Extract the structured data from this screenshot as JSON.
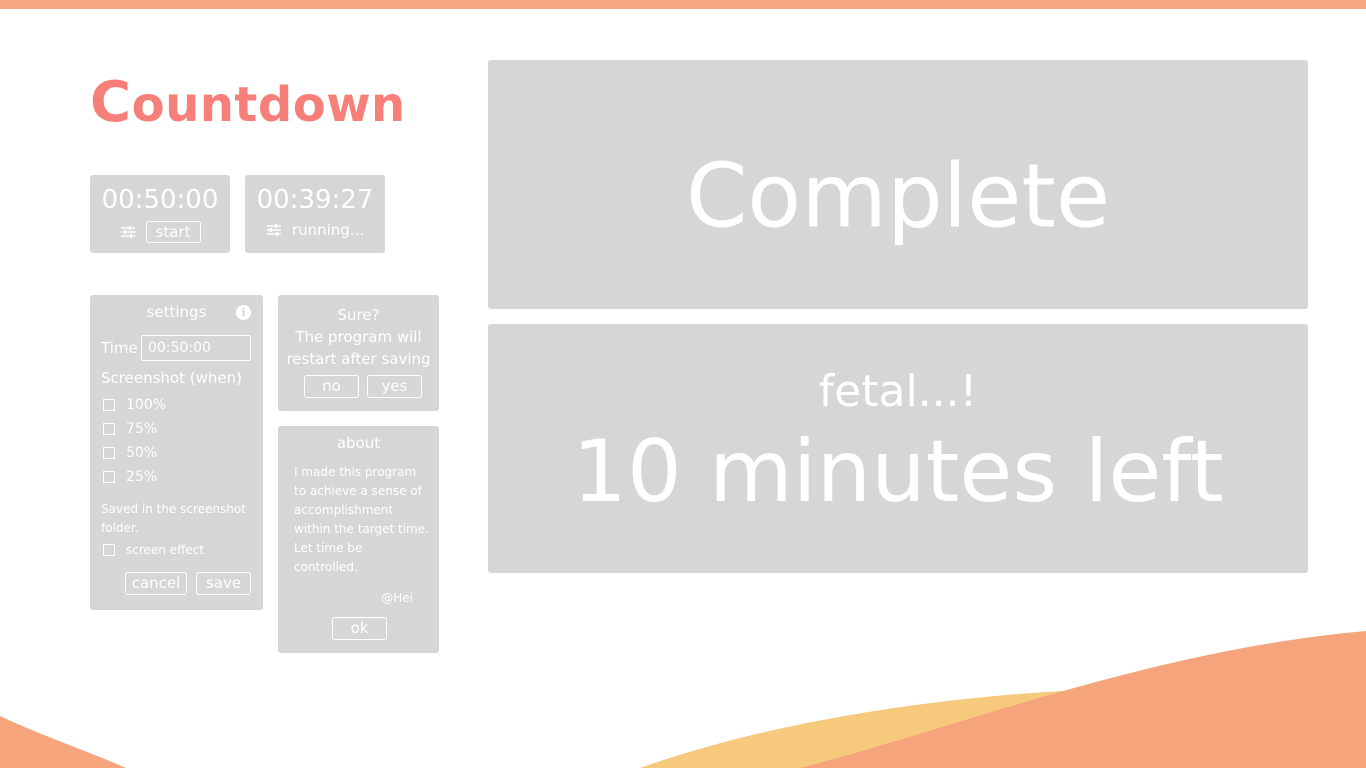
{
  "app": {
    "title": "Countdown"
  },
  "colors": {
    "accent": "#f77f7a",
    "top_bar": "#f8a882",
    "panel": "#d6d6d6",
    "wave_orange": "#f6a47b",
    "wave_yellow": "#f6c97d"
  },
  "timers": [
    {
      "time": "00:50:00",
      "icon": "sliders-icon",
      "action_label": "start"
    },
    {
      "time": "00:39:27",
      "icon": "sliders-icon",
      "status": "running..."
    }
  ],
  "settings": {
    "heading": "settings",
    "info_icon": "info-icon",
    "time_label": "Time",
    "time_value": "00:50:00",
    "screenshot_label": "Screenshot (when)",
    "options": [
      {
        "label": "100%",
        "checked": false
      },
      {
        "label": "75%",
        "checked": false
      },
      {
        "label": "50%",
        "checked": false
      },
      {
        "label": "25%",
        "checked": false
      }
    ],
    "note": "Saved in the screenshot folder.",
    "screen_effect_label": "screen effect",
    "screen_effect_checked": false,
    "cancel_label": "cancel",
    "save_label": "save"
  },
  "confirm": {
    "line1": "Sure?",
    "line2": "The program will",
    "line3": "restart after saving",
    "no_label": "no",
    "yes_label": "yes"
  },
  "about": {
    "heading": "about",
    "body": "I made this program to achieve a sense of accomplishment within the target time. Let time be controlled.",
    "signature": "@Hei",
    "ok_label": "ok"
  },
  "display": {
    "complete_text": "Complete",
    "sub_text": "fetal...!",
    "main_text": "10 minutes left"
  }
}
